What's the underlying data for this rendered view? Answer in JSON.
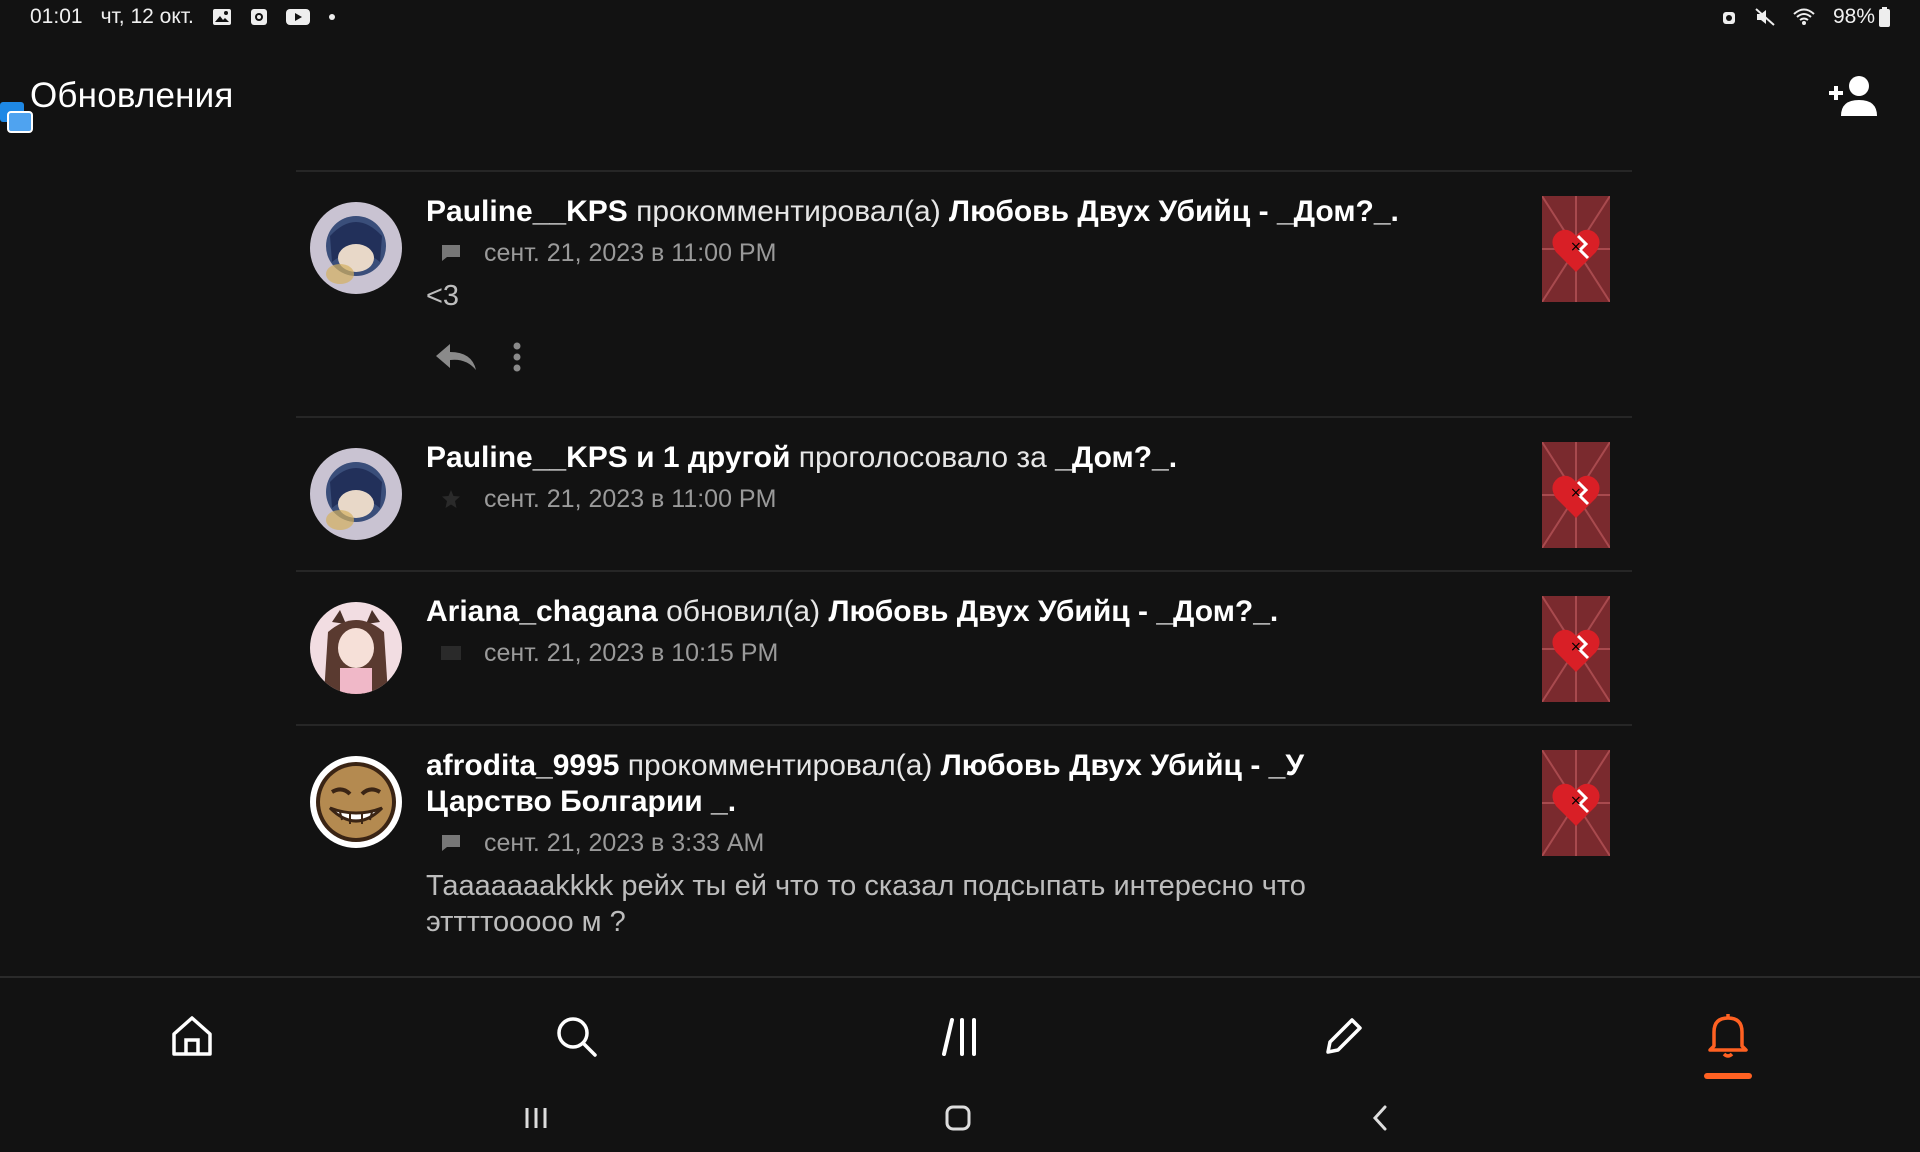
{
  "status_bar": {
    "time": "01:01",
    "date": "чт, 12 окт.",
    "battery": "98%"
  },
  "header": {
    "title": "Обновления"
  },
  "colors": {
    "accent": "#ff6122",
    "background": "#121212"
  },
  "feed": [
    {
      "user": "Pauline__KPS",
      "action": "прокомментировал(а)",
      "target": "Любовь Двух Убийц - _Дом?_.",
      "timestamp": "сент. 21, 2023 в 11:00 PM",
      "meta_icon": "comment-icon",
      "comment": "<3"
    },
    {
      "user": "Pauline__KPS и 1 другой",
      "action": "проголосовало за",
      "target": "_Дом?_.",
      "timestamp": "сент. 21, 2023 в 11:00 PM",
      "meta_icon": "star-icon"
    },
    {
      "user": "Ariana_chagana",
      "action": "обновил(а)",
      "target": "Любовь Двух Убийц - _Дом?_.",
      "timestamp": "сент. 21, 2023 в 10:15 PM",
      "meta_icon": "book-icon"
    },
    {
      "user": "afrodita_9995",
      "action": "прокомментировал(а)",
      "target": "Любовь Двух Убийц - _У Царство Болгарии _.",
      "timestamp": "сент. 21, 2023 в 3:33 AM",
      "meta_icon": "comment-icon",
      "comment": "Таааааааkkkk рейх ты ей что то сказал подсыпать интересно что эттттооооо м ?"
    }
  ],
  "bottom_nav": [
    {
      "icon": "home-icon"
    },
    {
      "icon": "search-icon"
    },
    {
      "icon": "library-icon"
    },
    {
      "icon": "write-icon"
    },
    {
      "icon": "bell-icon",
      "active": true
    }
  ]
}
